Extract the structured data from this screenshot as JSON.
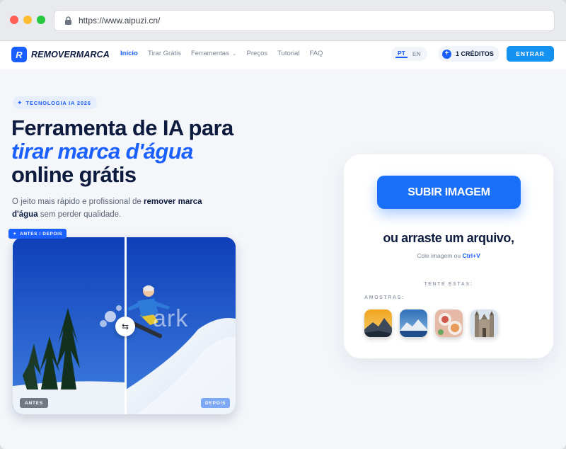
{
  "browser": {
    "url": "https://www.aipuzi.cn/"
  },
  "header": {
    "logo_letter": "R",
    "logo_text": "REMOVERMARCA",
    "nav": [
      {
        "label": "Início",
        "active": true
      },
      {
        "label": "Tirar Grátis"
      },
      {
        "label": "Ferramentas",
        "has_dropdown": true
      },
      {
        "label": "Preços"
      },
      {
        "label": "Tutorial"
      },
      {
        "label": "FAQ"
      }
    ],
    "lang_active": "PT",
    "lang_other": "EN",
    "credits_icon": "+",
    "credits": "1 CRÉDITOS",
    "enter": "ENTRAR"
  },
  "hero": {
    "badge": "TECNOLOGIA IA 2026",
    "title_line1": "Ferramenta de IA para",
    "title_line2": "tirar marca d'água",
    "title_line3": "online grátis",
    "lead_part1": "O jeito mais rápido e profissional de ",
    "lead_bold": "remover marca d'água",
    "lead_part2": " sem perder qualidade."
  },
  "compare": {
    "tag": "ANTES / DEPOIS",
    "before": "ANTES",
    "after": "DEPOIS",
    "watermark": "ark",
    "handle_icon": "⇆"
  },
  "upload": {
    "button": "SUBIR IMAGEM",
    "drag": "ou arraste um arquivo,",
    "paste_prefix": "Cole imagem ou ",
    "paste_shortcut": "Ctrl+V",
    "try_label": "TENTE ESTAS:",
    "samples_label": "AMOSTRAS:",
    "samples": [
      "mountain-sunset",
      "mountain-lake",
      "food-plate",
      "cathedral"
    ]
  },
  "colors": {
    "primary": "#1a5fff",
    "button": "#1a6ff8",
    "enter": "#1591f0",
    "text_dark": "#0d1b3e"
  }
}
